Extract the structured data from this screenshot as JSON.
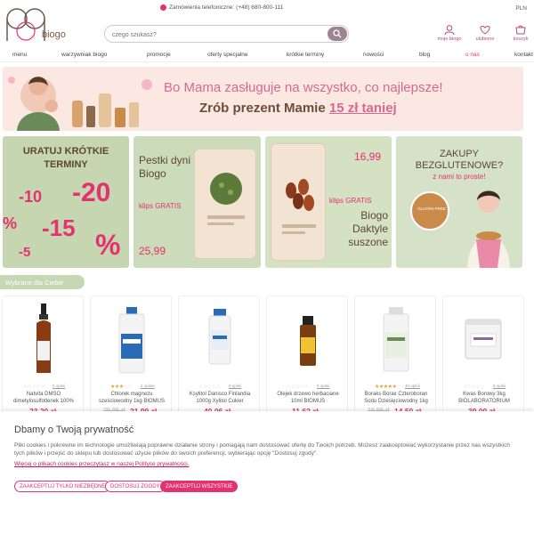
{
  "header": {
    "logo_text": "biogo",
    "phone": "Zamówienia telefoniczne: (+48) 680-800-111",
    "language": "PLN",
    "search_placeholder": "czego szukasz?",
    "icons": [
      {
        "label": "moje biogo",
        "icon": "user-icon"
      },
      {
        "label": "ulubione",
        "icon": "heart-icon"
      },
      {
        "label": "koszyk",
        "icon": "cart-icon"
      }
    ],
    "accent": "#e4316f"
  },
  "nav": {
    "items": [
      "menu",
      "warzywniak biogo",
      "promocje",
      "oferty specjalne",
      "krótkie terminy",
      "nowości",
      "blog",
      "o nas",
      "kontakt"
    ]
  },
  "hero": {
    "line1": "Bo Mama zasługuje na wszystko, co najlepsze!",
    "line2_prefix": "Zrób prezent Mamie",
    "line2_highlight": "15 zł taniej"
  },
  "tiles": {
    "t1": {
      "title": "URATUJ KRÓTKIE TERMINY",
      "numbers": [
        "-10",
        "-20",
        "-15",
        "-5",
        "%",
        "%"
      ]
    },
    "t2": {
      "title": "Pestki dyni Biogo",
      "clip": "klips GRATIS",
      "price": "25,99"
    },
    "t3": {
      "price": "16,99",
      "clip": "klips GRATIS",
      "title": "Biogo Daktyle suszone"
    },
    "t4": {
      "title": "ZAKUPY BEZGLUTENOWE?",
      "subtitle": "z nami to proste!",
      "seal": "GLUTEN FREE"
    }
  },
  "section": {
    "title": "Wybrane dla Ciebie"
  },
  "products": [
    {
      "name": "Natvita DMSO dimetylosulfotlenek 100%",
      "stars": 0,
      "opinions": "0 opinii",
      "old_price": "",
      "price": "23,20 zł"
    },
    {
      "name": "Chlorek magnezu sześciowodny 1kg BIOMUS",
      "stars": 3,
      "opinions": "2 opinie",
      "old_price": "29,99 zł",
      "price": "21,99 zł"
    },
    {
      "name": "Ksylitol Danisco Finlandia 1000g Xylitol Cukier",
      "stars": 0,
      "opinions": "0 opinii",
      "old_price": "",
      "price": "40,06 zł"
    },
    {
      "name": "Olejek drzewo herbaciane 10ml BIOMUS",
      "stars": 0,
      "opinions": "0 opinii",
      "old_price": "",
      "price": "11,62 zł"
    },
    {
      "name": "Boraks Borax Czteroboran Sodu Dziesięciowodny 1kg",
      "stars": 5,
      "opinions": "40 opinii",
      "old_price": "18,99 zł",
      "price": "14,50 zł"
    },
    {
      "name": "Kwas Borowy 3kg BIOLABORATORIUM",
      "stars": 0,
      "opinions": "0 opinii",
      "old_price": "",
      "price": "39,00 zł"
    }
  ],
  "cookie": {
    "title": "Dbamy o Twoją prywatność",
    "text": "Pliki cookies i pokrewne im technologie umożliwiają poprawne działanie strony i pomagają nam dostosować ofertę do Twoich potrzeb. Możesz zaakceptować wykorzystanie przez nas wszystkich tych plików i przejść do sklepu lub dostosować użycie plików do swoich preferencji, wybierając opcję \"Dostosuj zgody\".",
    "link": "Więcej o plikach cookies przeczytasz w naszej Polityce prywatności.",
    "btn_necessary": "ZAAKCEPTUJ TYLKO NIEZBĘDNE",
    "btn_customize": "DOSTOSUJ ZGODY",
    "btn_accept_all": "ZAAKCEPTUJ WSZYSTKIE"
  }
}
